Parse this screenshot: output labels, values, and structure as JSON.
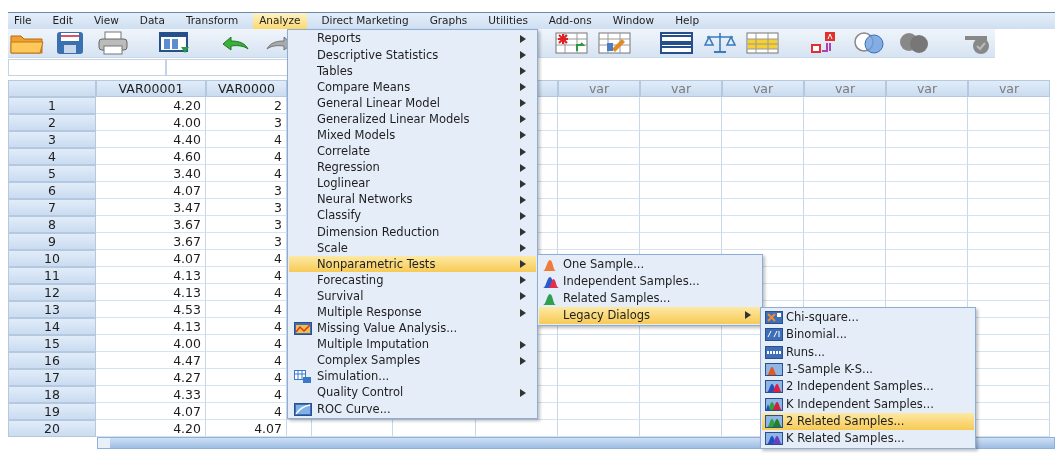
{
  "menubar": [
    {
      "label": "File",
      "selected": false
    },
    {
      "label": "Edit",
      "selected": false
    },
    {
      "label": "View",
      "selected": false
    },
    {
      "label": "Data",
      "selected": false
    },
    {
      "label": "Transform",
      "selected": false
    },
    {
      "label": "Analyze",
      "selected": true
    },
    {
      "label": "Direct Marketing",
      "selected": false
    },
    {
      "label": "Graphs",
      "selected": false
    },
    {
      "label": "Utilities",
      "selected": false
    },
    {
      "label": "Add-ons",
      "selected": false
    },
    {
      "label": "Window",
      "selected": false
    },
    {
      "label": "Help",
      "selected": false
    }
  ],
  "grid": {
    "columns": [
      {
        "label": "VAR00001"
      },
      {
        "label": "VAR0000"
      }
    ],
    "var_columns": [
      "var",
      "var",
      "var",
      "var",
      "var",
      "var"
    ],
    "rows": [
      {
        "number": "1",
        "cells": [
          "4.20",
          "2"
        ]
      },
      {
        "number": "2",
        "cells": [
          "4.00",
          "3"
        ]
      },
      {
        "number": "3",
        "cells": [
          "4.40",
          "4"
        ]
      },
      {
        "number": "4",
        "cells": [
          "4.60",
          "4"
        ]
      },
      {
        "number": "5",
        "cells": [
          "3.40",
          "4"
        ]
      },
      {
        "number": "6",
        "cells": [
          "4.07",
          "3"
        ]
      },
      {
        "number": "7",
        "cells": [
          "3.47",
          "3"
        ]
      },
      {
        "number": "8",
        "cells": [
          "3.67",
          "3"
        ]
      },
      {
        "number": "9",
        "cells": [
          "3.67",
          "3"
        ]
      },
      {
        "number": "10",
        "cells": [
          "4.07",
          "4"
        ]
      },
      {
        "number": "11",
        "cells": [
          "4.13",
          "4"
        ]
      },
      {
        "number": "12",
        "cells": [
          "4.13",
          "4"
        ]
      },
      {
        "number": "13",
        "cells": [
          "4.53",
          "4"
        ]
      },
      {
        "number": "14",
        "cells": [
          "4.13",
          "4"
        ]
      },
      {
        "number": "15",
        "cells": [
          "4.00",
          "4"
        ]
      },
      {
        "number": "16",
        "cells": [
          "4.47",
          "4"
        ]
      },
      {
        "number": "17",
        "cells": [
          "4.27",
          "4"
        ]
      },
      {
        "number": "18",
        "cells": [
          "4.33",
          "4"
        ]
      },
      {
        "number": "19",
        "cells": [
          "4.07",
          "4"
        ]
      },
      {
        "number": "20",
        "cells": [
          "4.20",
          "4.07"
        ]
      }
    ]
  },
  "analyze_menu": {
    "items": [
      {
        "label": "Reports",
        "kind": "submenu",
        "selected": false
      },
      {
        "label": "Descriptive Statistics",
        "kind": "submenu",
        "selected": false
      },
      {
        "label": "Tables",
        "kind": "submenu",
        "selected": false
      },
      {
        "label": "Compare Means",
        "kind": "submenu",
        "selected": false
      },
      {
        "label": "General Linear Model",
        "kind": "submenu",
        "selected": false
      },
      {
        "label": "Generalized Linear Models",
        "kind": "submenu",
        "selected": false
      },
      {
        "label": "Mixed Models",
        "kind": "submenu",
        "selected": false
      },
      {
        "label": "Correlate",
        "kind": "submenu",
        "selected": false
      },
      {
        "label": "Regression",
        "kind": "submenu",
        "selected": false
      },
      {
        "label": "Loglinear",
        "kind": "submenu",
        "selected": false
      },
      {
        "label": "Neural Networks",
        "kind": "submenu",
        "selected": false
      },
      {
        "label": "Classify",
        "kind": "submenu",
        "selected": false
      },
      {
        "label": "Dimension Reduction",
        "kind": "submenu",
        "selected": false
      },
      {
        "label": "Scale",
        "kind": "submenu",
        "selected": false
      },
      {
        "label": "Nonparametric Tests",
        "kind": "submenu",
        "selected": true
      },
      {
        "label": "Forecasting",
        "kind": "submenu",
        "selected": false
      },
      {
        "label": "Survival",
        "kind": "submenu",
        "selected": false
      },
      {
        "label": "Multiple Response",
        "kind": "submenu",
        "selected": false
      },
      {
        "label": "Missing Value Analysis...",
        "kind": "dialog",
        "selected": false
      },
      {
        "label": "Multiple Imputation",
        "kind": "submenu",
        "selected": false
      },
      {
        "label": "Complex Samples",
        "kind": "submenu",
        "selected": false
      },
      {
        "label": "Simulation...",
        "kind": "dialog",
        "selected": false
      },
      {
        "label": "Quality Control",
        "kind": "submenu",
        "selected": false
      },
      {
        "label": "ROC Curve...",
        "kind": "dialog",
        "selected": false
      }
    ]
  },
  "nonparametric_menu": {
    "items": [
      {
        "label": "One Sample...",
        "kind": "dialog",
        "selected": false
      },
      {
        "label": "Independent Samples...",
        "kind": "dialog",
        "selected": false
      },
      {
        "label": "Related Samples...",
        "kind": "dialog",
        "selected": false
      },
      {
        "label": "Legacy Dialogs",
        "kind": "submenu",
        "selected": true
      }
    ]
  },
  "legacy_dialogs_menu": {
    "items": [
      {
        "label": "Chi-square...",
        "kind": "dialog",
        "selected": false
      },
      {
        "label": "Binomial...",
        "kind": "dialog",
        "selected": false
      },
      {
        "label": "Runs...",
        "kind": "dialog",
        "selected": false
      },
      {
        "label": "1-Sample K-S...",
        "kind": "dialog",
        "selected": false
      },
      {
        "label": "2 Independent Samples...",
        "kind": "dialog",
        "selected": false
      },
      {
        "label": "K Independent Samples...",
        "kind": "dialog",
        "selected": false
      },
      {
        "label": "2 Related Samples...",
        "kind": "dialog",
        "selected": true
      },
      {
        "label": "K Related Samples...",
        "kind": "dialog",
        "selected": false
      }
    ]
  }
}
